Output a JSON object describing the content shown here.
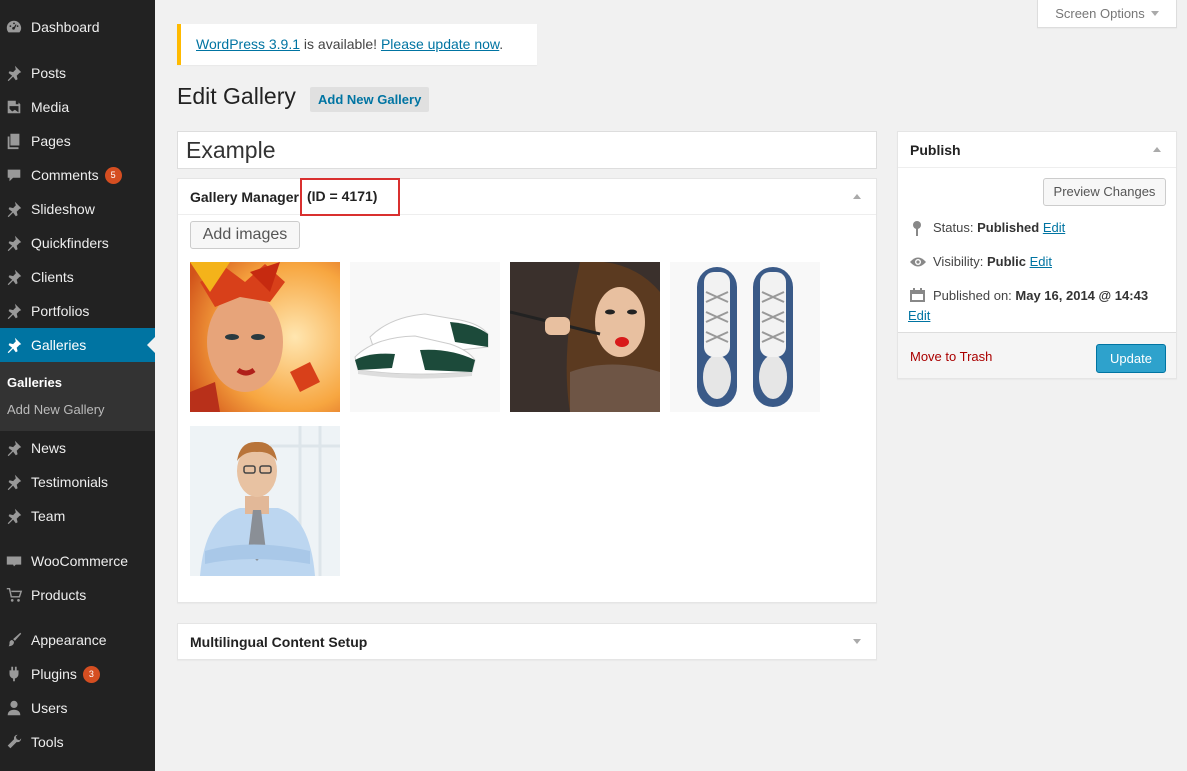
{
  "sidebar": {
    "items": [
      {
        "label": "Dashboard",
        "icon": "dashboard-icon"
      },
      {
        "label": "Posts",
        "icon": "pin-icon"
      },
      {
        "label": "Media",
        "icon": "media-icon"
      },
      {
        "label": "Pages",
        "icon": "pages-icon"
      },
      {
        "label": "Comments",
        "icon": "comment-icon",
        "badge": "5"
      },
      {
        "label": "Slideshow",
        "icon": "pin-icon"
      },
      {
        "label": "Quickfinders",
        "icon": "pin-icon"
      },
      {
        "label": "Clients",
        "icon": "pin-icon"
      },
      {
        "label": "Portfolios",
        "icon": "pin-icon"
      },
      {
        "label": "Galleries",
        "icon": "pin-icon",
        "active": true
      },
      {
        "label": "News",
        "icon": "pin-icon"
      },
      {
        "label": "Testimonials",
        "icon": "pin-icon"
      },
      {
        "label": "Team",
        "icon": "pin-icon"
      },
      {
        "label": "WooCommerce",
        "icon": "woo-icon"
      },
      {
        "label": "Products",
        "icon": "cart-icon"
      },
      {
        "label": "Appearance",
        "icon": "brush-icon"
      },
      {
        "label": "Plugins",
        "icon": "plugin-icon",
        "badge": "3"
      },
      {
        "label": "Users",
        "icon": "user-icon"
      },
      {
        "label": "Tools",
        "icon": "wrench-icon"
      }
    ],
    "submenu": {
      "current": "Galleries",
      "add_new": "Add New Gallery"
    }
  },
  "screen_options": "Screen Options",
  "update_nag": {
    "version_link": "WordPress 3.9.1",
    "middle": " is available! ",
    "update_link": "Please update now",
    "end": "."
  },
  "page": {
    "title": "Edit Gallery",
    "add_new_button": "Add New Gallery",
    "post_title": "Example"
  },
  "gallery_box": {
    "title": "Gallery Manager",
    "id_label": "(ID = 4171)",
    "add_images_button": "Add images"
  },
  "multilingual_box": {
    "title": "Multilingual Content Setup"
  },
  "publish": {
    "title": "Publish",
    "preview_button": "Preview Changes",
    "status_label": "Status: ",
    "status_value": "Published",
    "status_edit": "Edit",
    "visibility_label": "Visibility: ",
    "visibility_value": "Public",
    "visibility_edit": "Edit",
    "published_label": "Published on: ",
    "published_value": "May 16, 2014 @ 14:43",
    "published_edit": "Edit",
    "trash_link": "Move to Trash",
    "update_button": "Update"
  },
  "colors": {
    "accent": "#0074a2",
    "sidebar_bg": "#222222",
    "update_border": "#ffba00",
    "highlight": "#d9302f",
    "button_primary": "#2ea2cc"
  }
}
